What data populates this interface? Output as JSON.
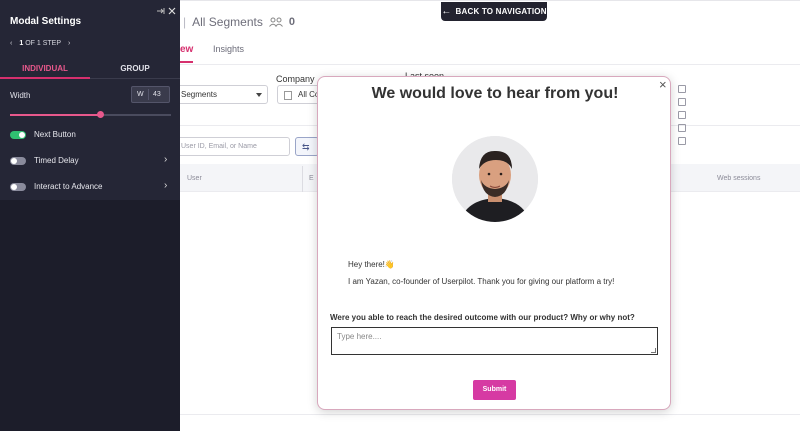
{
  "sidebar": {
    "title": "Modal Settings",
    "step_prev": "‹",
    "step_current": "1",
    "step_text": "OF 1 STEP",
    "step_next": "›",
    "tabs": [
      "INDIVIDUAL",
      "GROUP"
    ],
    "width_label": "Width",
    "width_unit": "W",
    "width_value": "43",
    "slider_fraction": 0.56,
    "options": [
      {
        "label": "Next Button",
        "enabled": true,
        "has_chevron": false
      },
      {
        "label": "Timed Delay",
        "enabled": false,
        "has_chevron": true
      },
      {
        "label": "Interact to Advance",
        "enabled": false,
        "has_chevron": true
      }
    ],
    "chevron": "›"
  },
  "back_nav": {
    "label": "BACK TO NAVIGATION",
    "arrow": "←"
  },
  "background": {
    "title_sep": "|",
    "title": "All Segments",
    "count": "0",
    "tab_active": "ew",
    "tab_other": "Insights",
    "company_label": "Company",
    "last_label": "Last seen",
    "segments_select": "Segments",
    "company_select": "All Co",
    "search_placeholder": "User ID, Email, or Name",
    "filter_icon": "⇆",
    "col_user": "User",
    "col_e": "E",
    "col_web": "Web sessions"
  },
  "modal": {
    "close": "×",
    "title": "We would love to hear from you!",
    "greeting": "Hey there!👋",
    "intro": "I am Yazan, co-founder of Userpilot. Thank you for giving our platform a try!",
    "question": "Were you able to reach the desired outcome with our product? Why or why not?",
    "placeholder": "Type here....",
    "submit": "Submit"
  },
  "colors": {
    "accent": "#d6306e",
    "sidebar_bg": "#1c1d2a",
    "toggle_on": "#2fbf71",
    "submit_bg": "#d63aa3"
  }
}
